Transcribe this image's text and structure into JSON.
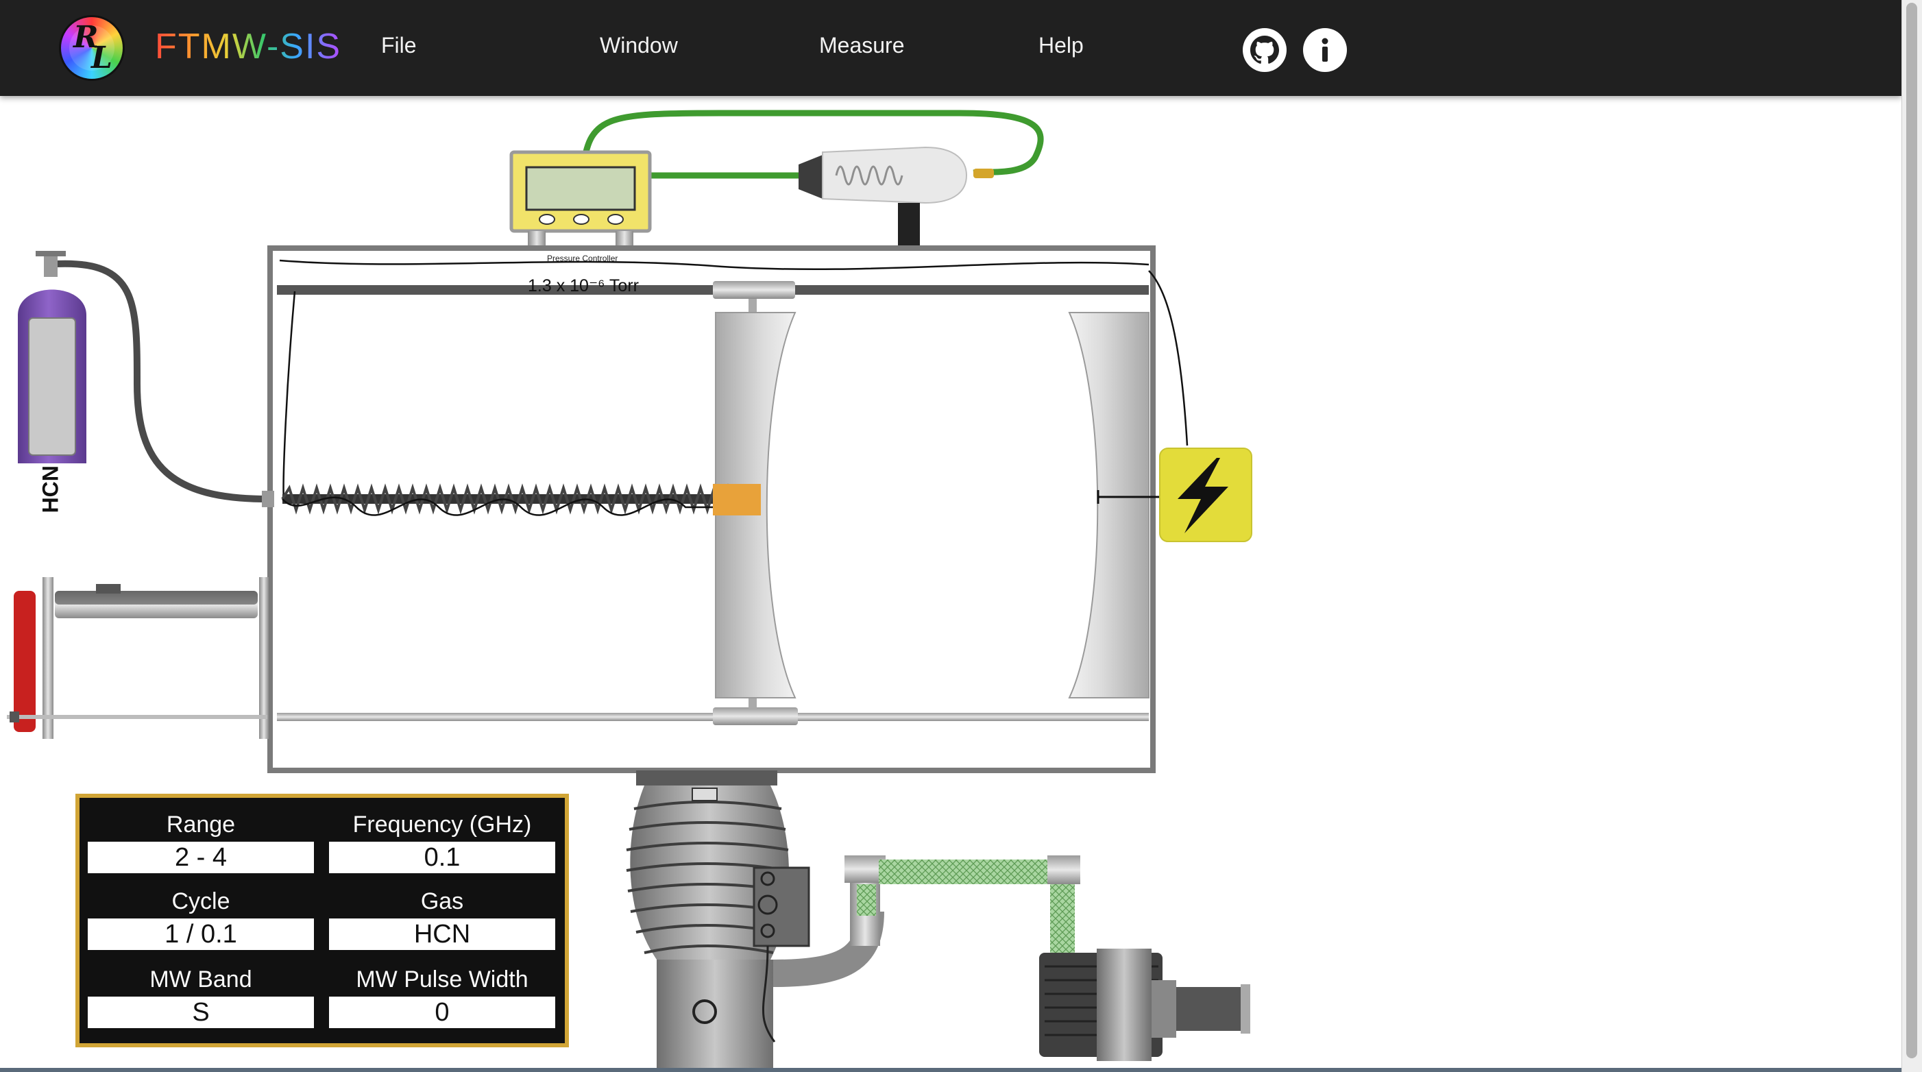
{
  "app": {
    "brand": "FTMW-SIS",
    "logo": {
      "letter_top": "R",
      "letter_bottom": "L"
    }
  },
  "menu": {
    "items": [
      {
        "label": "File"
      },
      {
        "label": "Window"
      },
      {
        "label": "Measure"
      },
      {
        "label": "Help"
      }
    ]
  },
  "nav_icons": [
    "github-icon",
    "info-icon"
  ],
  "apparatus": {
    "pressure_controller": {
      "title": "Pressure Controller",
      "reading": "1.3 x 10⁻⁶ Torr"
    },
    "gas_cylinder": {
      "label": "HCN"
    },
    "power_icon": "lightning-bolt-icon"
  },
  "parameters": {
    "range": {
      "label": "Range",
      "value": "2 - 4"
    },
    "frequency": {
      "label": "Frequency (GHz)",
      "value": "0.1"
    },
    "cycle": {
      "label": "Cycle",
      "value": "1 / 0.1"
    },
    "gas": {
      "label": "Gas",
      "value": "HCN"
    },
    "mw_band": {
      "label": "MW Band",
      "value": "S"
    },
    "mw_pulse_width": {
      "label": "MW Pulse Width",
      "value": "0"
    }
  },
  "colors": {
    "navbar": "#202020",
    "panel_border": "#d1a536",
    "gas_cylinder": "#7a4fb0",
    "power_box": "#e3dc3a",
    "hose_green": "#3f9b2f",
    "valve_red": "#c8211f"
  }
}
